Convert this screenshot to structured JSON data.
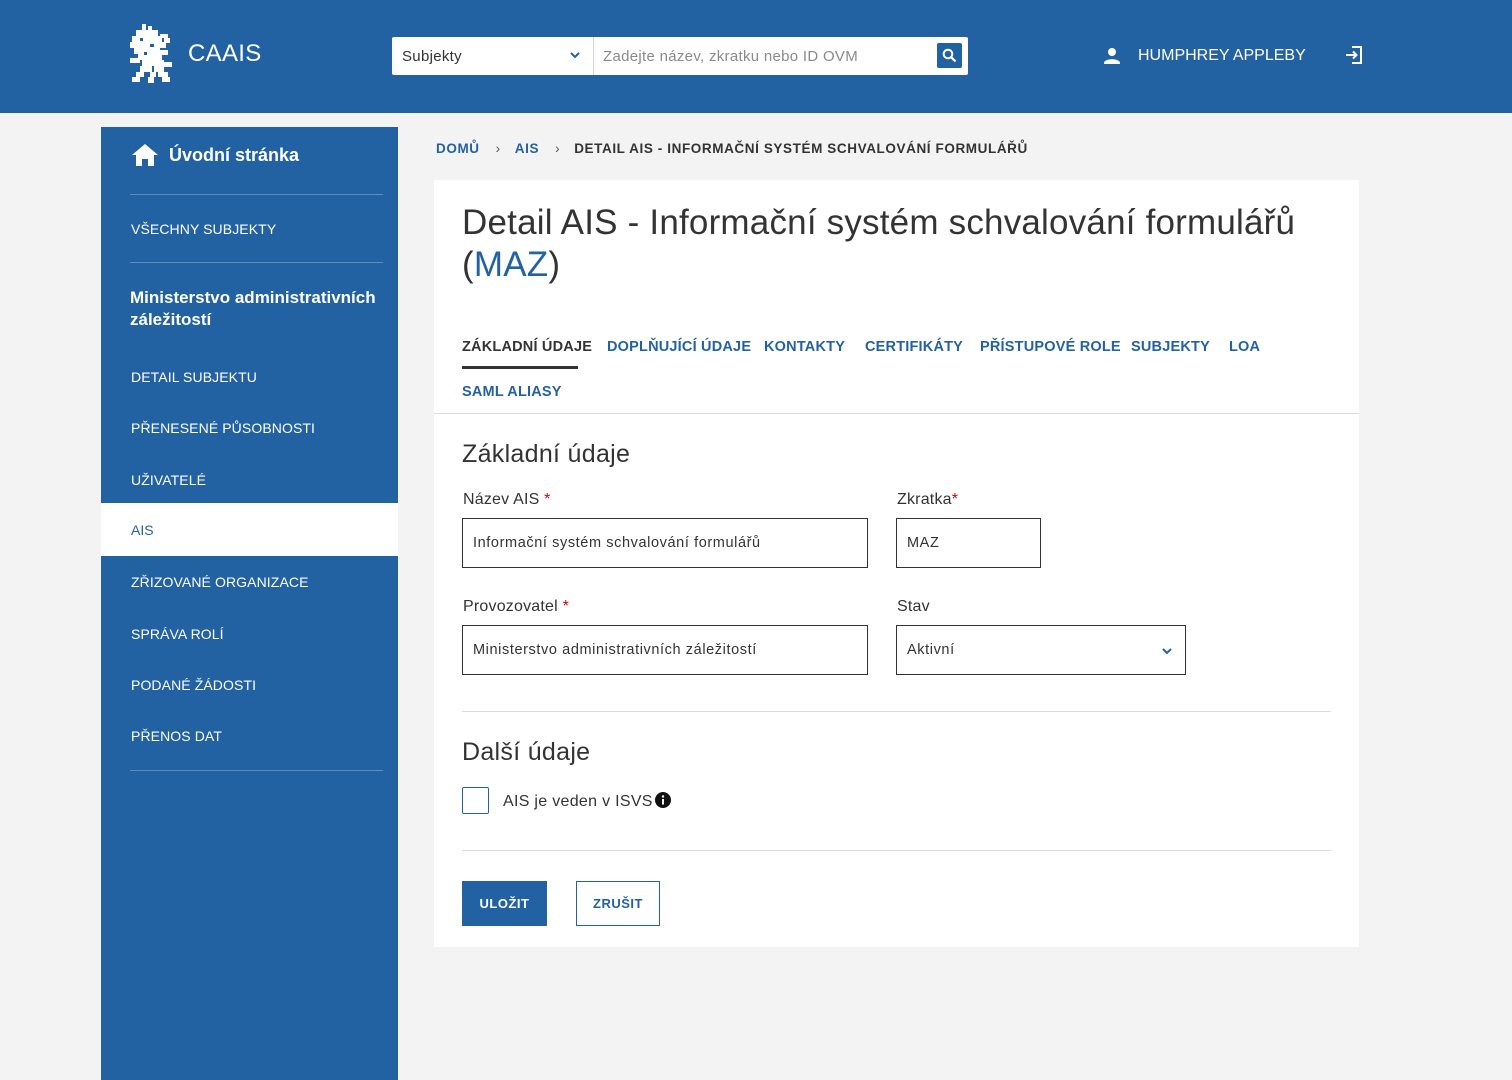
{
  "header": {
    "brand": "CAAIS",
    "search_scope": "Subjekty",
    "search_placeholder": "Zadejte název, zkratku nebo ID OVM",
    "user_name": "HUMPHREY APPLEBY",
    "icons": [
      "lion-logo-icon",
      "chevron-down-icon",
      "search-icon",
      "user-icon",
      "logout-icon"
    ]
  },
  "sidebar": {
    "home_label": "Úvodní stránka",
    "all_subjects": "VŠECHNY SUBJEKTY",
    "org_title": "Ministerstvo administrativních záležitostí",
    "items": [
      {
        "label": "Detail subjektu"
      },
      {
        "label": "Přenesené působnosti"
      },
      {
        "label": "Uživatelé"
      },
      {
        "label": "AIS"
      },
      {
        "label": "Zřizované organizace"
      },
      {
        "label": "Správa rolí"
      },
      {
        "label": "Podané žádosti"
      },
      {
        "label": "Přenos dat"
      }
    ],
    "active_index": 3
  },
  "breadcrumb": {
    "items": [
      "Domů",
      "AIS",
      "Detail AIS - Informační systém schvalování formulářů"
    ]
  },
  "page": {
    "title": "Detail AIS - Informační systém schvalování formulářů",
    "title_paren_open": "(",
    "title_abbr": "MAZ",
    "title_paren_close": ")"
  },
  "tabs": [
    {
      "label": "Základní údaje",
      "active": true
    },
    {
      "label": "Doplňující údaje"
    },
    {
      "label": "Kontakty"
    },
    {
      "label": "Certifikáty"
    },
    {
      "label": "Přístupové role"
    },
    {
      "label": "Subjekty"
    },
    {
      "label": "LOA"
    },
    {
      "label": "SAML aliasy"
    }
  ],
  "form": {
    "section_basic": "Základní údaje",
    "name_label": "Název AIS",
    "name_value": "Informační systém schvalování formulářů",
    "abbr_label": "Zkratka",
    "abbr_value": "MAZ",
    "operator_label": "Provozovatel",
    "operator_value": "Ministerstvo administrativních záležitostí",
    "state_label": "Stav",
    "state_value": "Aktivní",
    "required_mark": "*",
    "section_other": "Další údaje",
    "isvs_label": "AIS je veden v ISVS",
    "isvs_checked": false,
    "save_label": "Uložit",
    "cancel_label": "Zrušit"
  },
  "colors": {
    "primary": "#2362a2",
    "required": "#d40000",
    "background": "#f3f3f3"
  }
}
